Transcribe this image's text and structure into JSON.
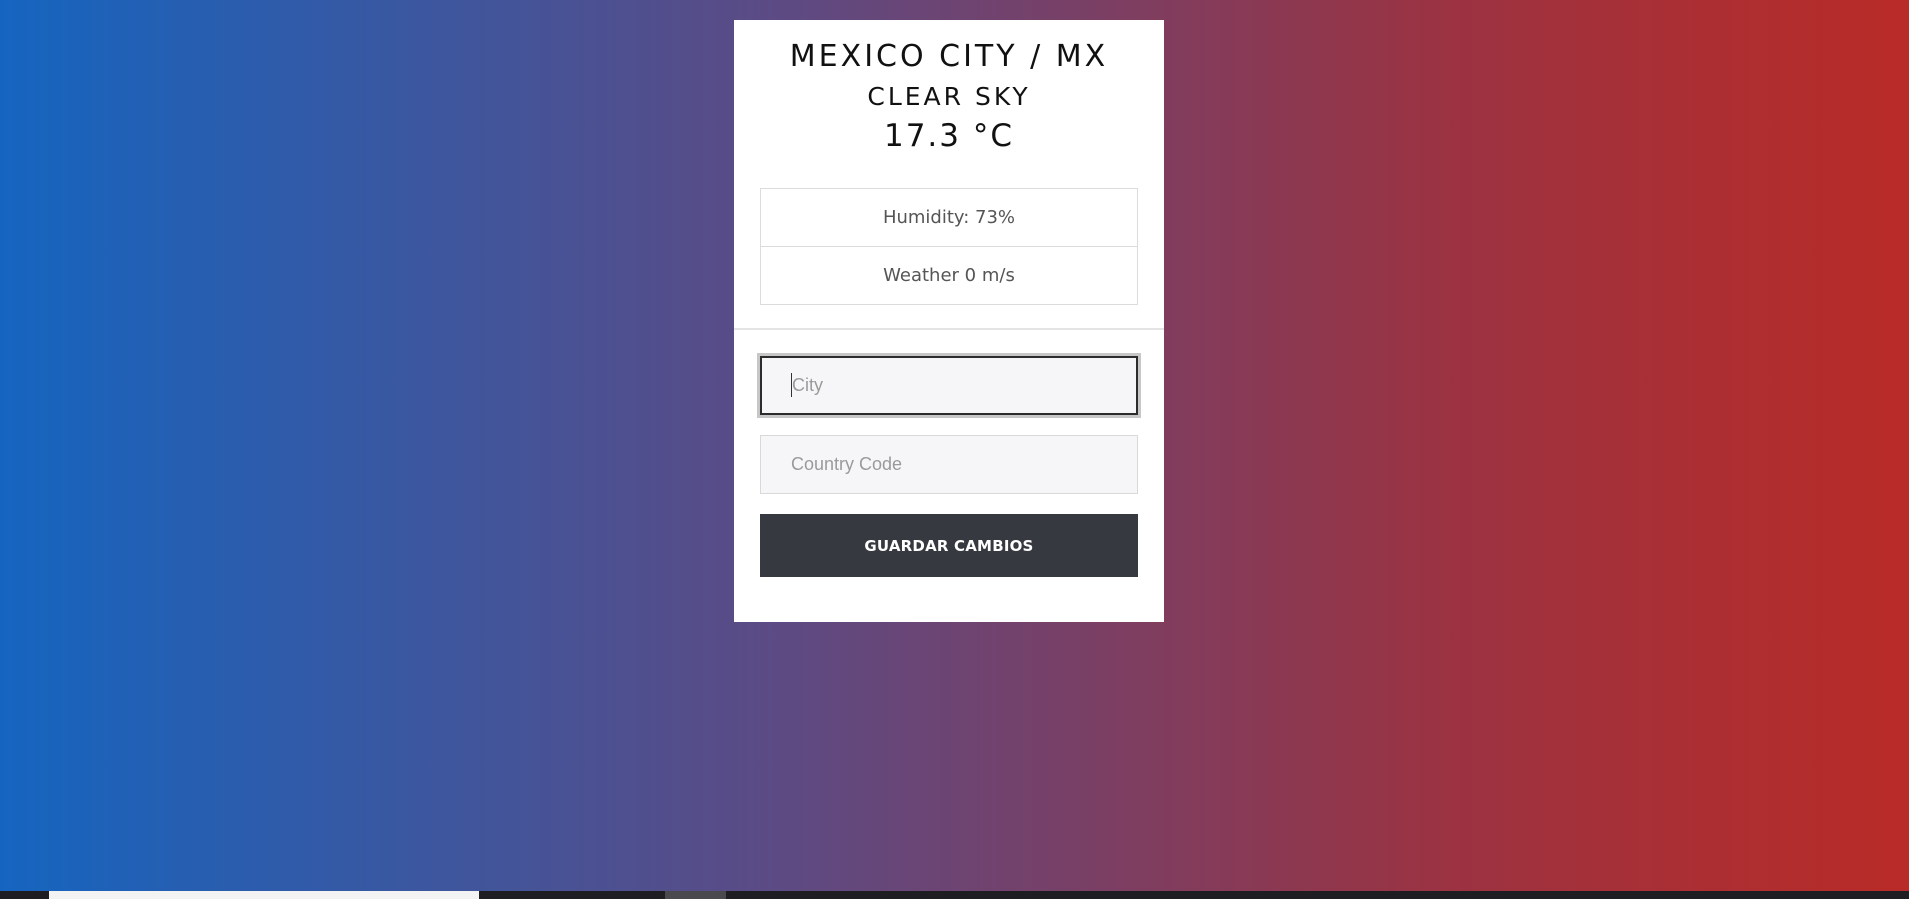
{
  "weather": {
    "location": "MEXICO CITY / MX",
    "description": "CLEAR SKY",
    "temperature": "17.3 °C",
    "humidity": "Humidity: 73%",
    "wind": "Weather 0 m/s"
  },
  "form": {
    "city_value": "",
    "city_placeholder": "City",
    "country_value": "",
    "country_placeholder": "Country Code",
    "submit_label": "GUARDAR CAMBIOS"
  },
  "colors": {
    "gradient_left": "#1565c0",
    "gradient_right": "#b92b27",
    "card_background": "#ffffff",
    "button_background": "#363a40",
    "input_background": "#f6f6f8"
  }
}
